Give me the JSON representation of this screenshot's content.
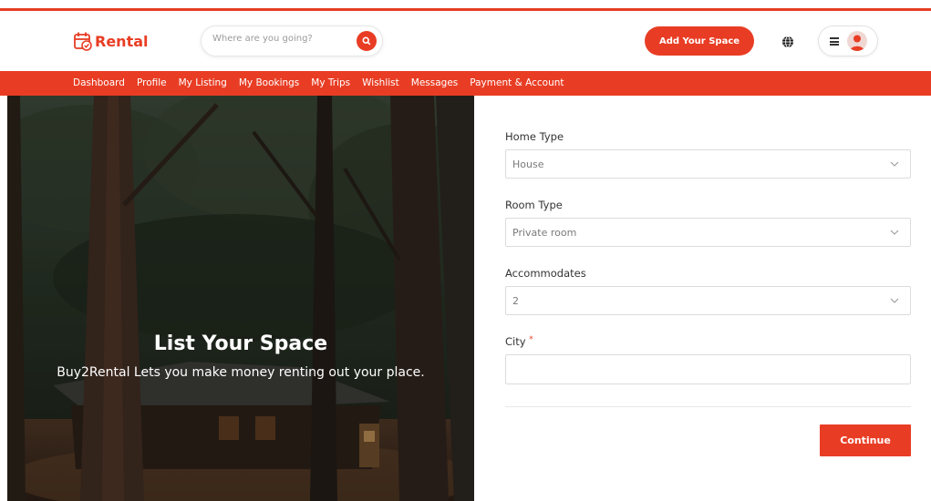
{
  "brand": {
    "name": "Rental",
    "accent": "#e83d24"
  },
  "search": {
    "placeholder": "Where are you going?"
  },
  "header": {
    "add_space_label": "Add Your Space"
  },
  "nav": {
    "items": [
      "Dashboard",
      "Profile",
      "My Listing",
      "My Bookings",
      "My Trips",
      "Wishlist",
      "Messages",
      "Payment & Account"
    ]
  },
  "hero": {
    "title": "List Your Space",
    "subtitle": "Buy2Rental Lets you make money renting out your place."
  },
  "form": {
    "home_type": {
      "label": "Home Type",
      "value": "House"
    },
    "room_type": {
      "label": "Room Type",
      "value": "Private room"
    },
    "accommodates": {
      "label": "Accommodates",
      "value": "2"
    },
    "city": {
      "label": "City",
      "required_mark": "*",
      "value": ""
    },
    "continue_label": "Continue"
  }
}
